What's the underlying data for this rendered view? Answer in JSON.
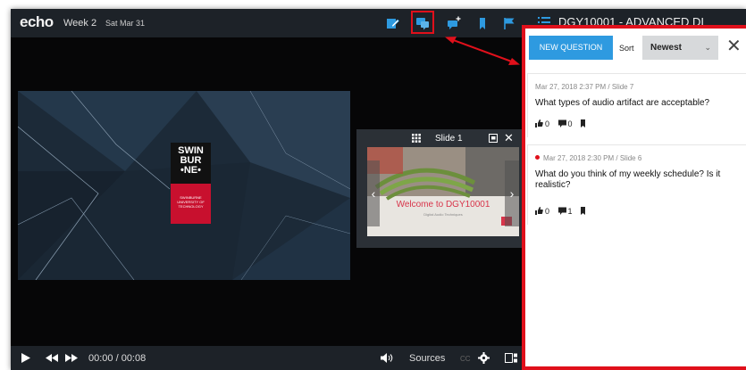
{
  "header": {
    "logo": "echo",
    "week": "Week 2",
    "date": "Sat Mar 31",
    "course_title": "DGY10001 - ADVANCED DI"
  },
  "toolbar_icons": [
    "notes-icon",
    "qa-icon",
    "add-comment-icon",
    "bookmark-icon",
    "flag-icon",
    "menu-icon"
  ],
  "video": {
    "logo_lines": [
      "SWIN",
      "BUR",
      "•NE•"
    ],
    "logo_subtext": "SWINBURNE UNIVERSITY OF TECHNOLOGY"
  },
  "slide_panel": {
    "label": "Slide 1",
    "welcome": "Welcome to DGY10001",
    "subtitle": "Digital Audio Techniques",
    "prev": "‹",
    "next": "›",
    "close": "✕"
  },
  "player": {
    "time": "00:00 / 00:08",
    "sources_label": "Sources",
    "cc_label": "CC"
  },
  "qa_panel": {
    "new_question_label": "NEW QUESTION",
    "sort_label": "Sort",
    "sort_value": "Newest",
    "close": "✕",
    "questions": [
      {
        "meta": "Mar 27, 2018 2:37 PM  /  Slide 7",
        "text": "What types of audio artifact are acceptable?",
        "likes": "0",
        "comments": "0",
        "unread": false
      },
      {
        "meta": "Mar 27, 2018 2:30 PM  /  Slide 6",
        "text": "What do you think of my weekly schedule? Is it realistic?",
        "likes": "0",
        "comments": "1",
        "unread": true
      }
    ]
  },
  "colors": {
    "accent_blue": "#2e9ae0",
    "highlight_red": "#e0101b",
    "swinburne_red": "#c8102e"
  }
}
